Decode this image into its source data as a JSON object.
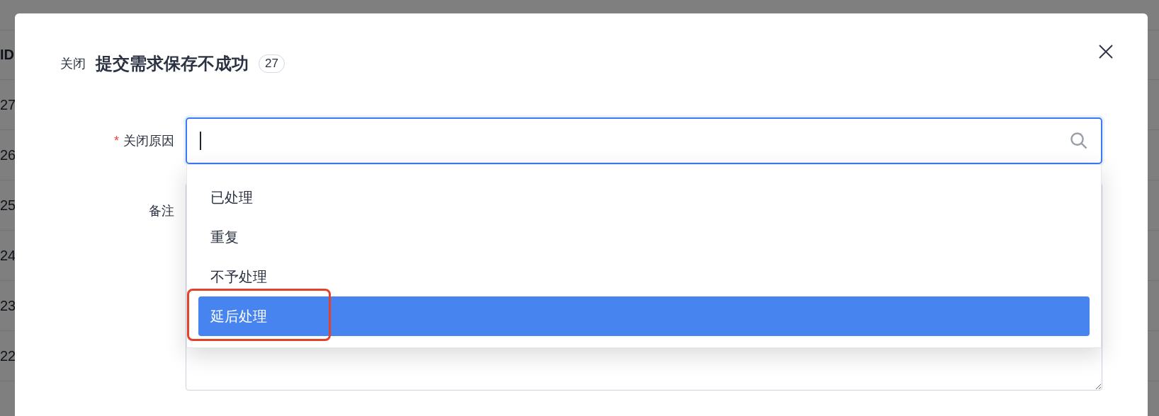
{
  "background": {
    "table": {
      "columns": [
        "ID"
      ],
      "rows": [
        "27",
        "26",
        "25",
        "24",
        "23",
        "22"
      ]
    }
  },
  "dialog": {
    "action": "关闭",
    "title": "提交需求保存不成功",
    "count": "27",
    "fields": [
      {
        "kind": "select",
        "label": "关闭原因",
        "required_mark": "*",
        "options": [
          {
            "label": "已处理",
            "selected": false,
            "highlighted": false
          },
          {
            "label": "重复",
            "selected": false,
            "highlighted": false
          },
          {
            "label": "不予处理",
            "selected": false,
            "highlighted": false
          },
          {
            "label": "延后处理",
            "selected": true,
            "highlighted": true
          }
        ]
      },
      {
        "kind": "textarea",
        "label": "备注"
      }
    ]
  }
}
